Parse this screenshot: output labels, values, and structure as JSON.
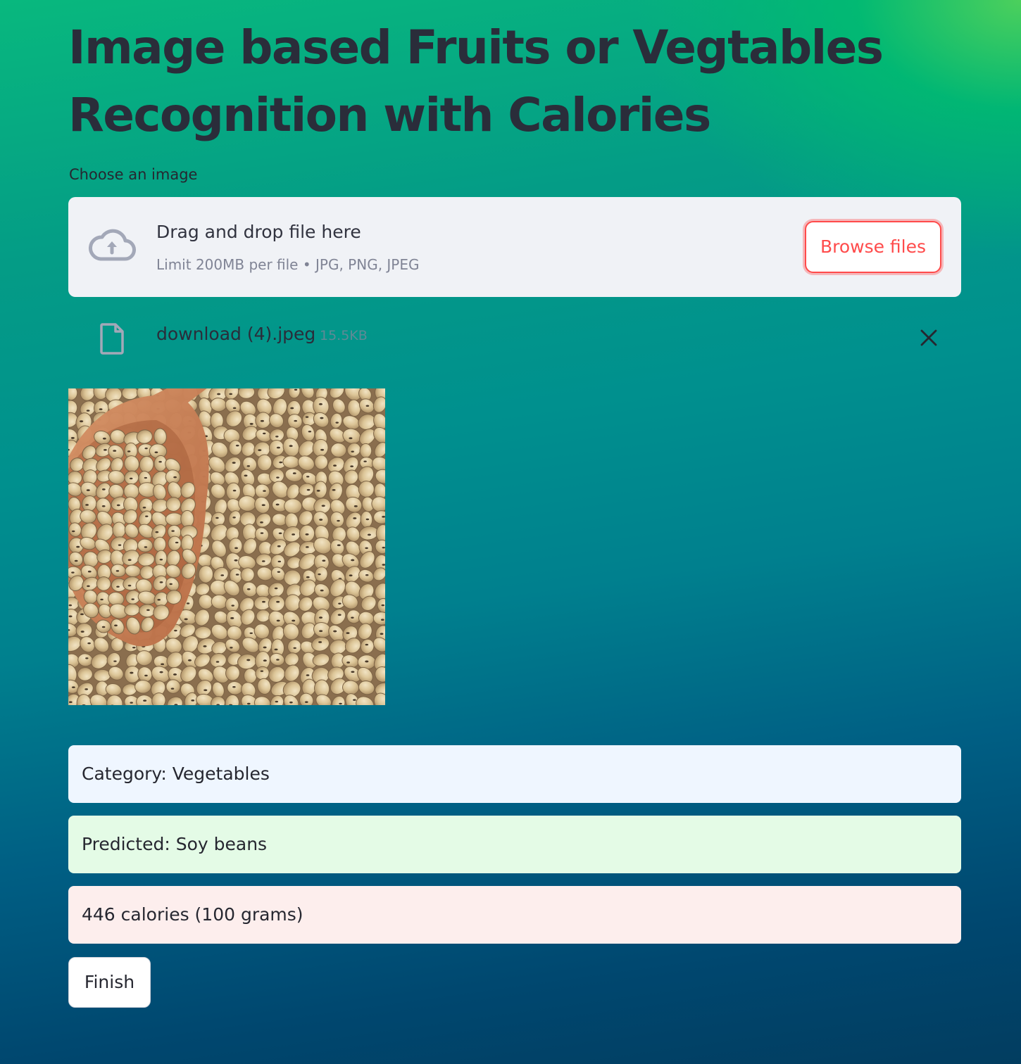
{
  "page": {
    "title": "Image based Fruits or Vegtables Recognition with Calories"
  },
  "uploader": {
    "label": "Choose an image",
    "drop_title": "Drag and drop file here",
    "drop_hint": "Limit 200MB per file • JPG, PNG, JPEG",
    "browse_label": "Browse files",
    "icon": "cloud-upload-icon"
  },
  "uploaded_file": {
    "name": "download (4).jpeg",
    "size": "15.5KB",
    "icon": "file-icon",
    "remove_icon": "close-icon"
  },
  "results": {
    "category": "Category: Vegetables",
    "predicted": "Predicted: Soy beans",
    "calories": "446 calories (100 grams)"
  },
  "actions": {
    "finish_label": "Finish"
  },
  "colors": {
    "accent": "#ff4b4b",
    "info_bg": "#eff6ff",
    "success_bg": "#e4fbe6",
    "error_bg": "#fdeeed",
    "dropzone_bg": "#f0f2f6"
  }
}
